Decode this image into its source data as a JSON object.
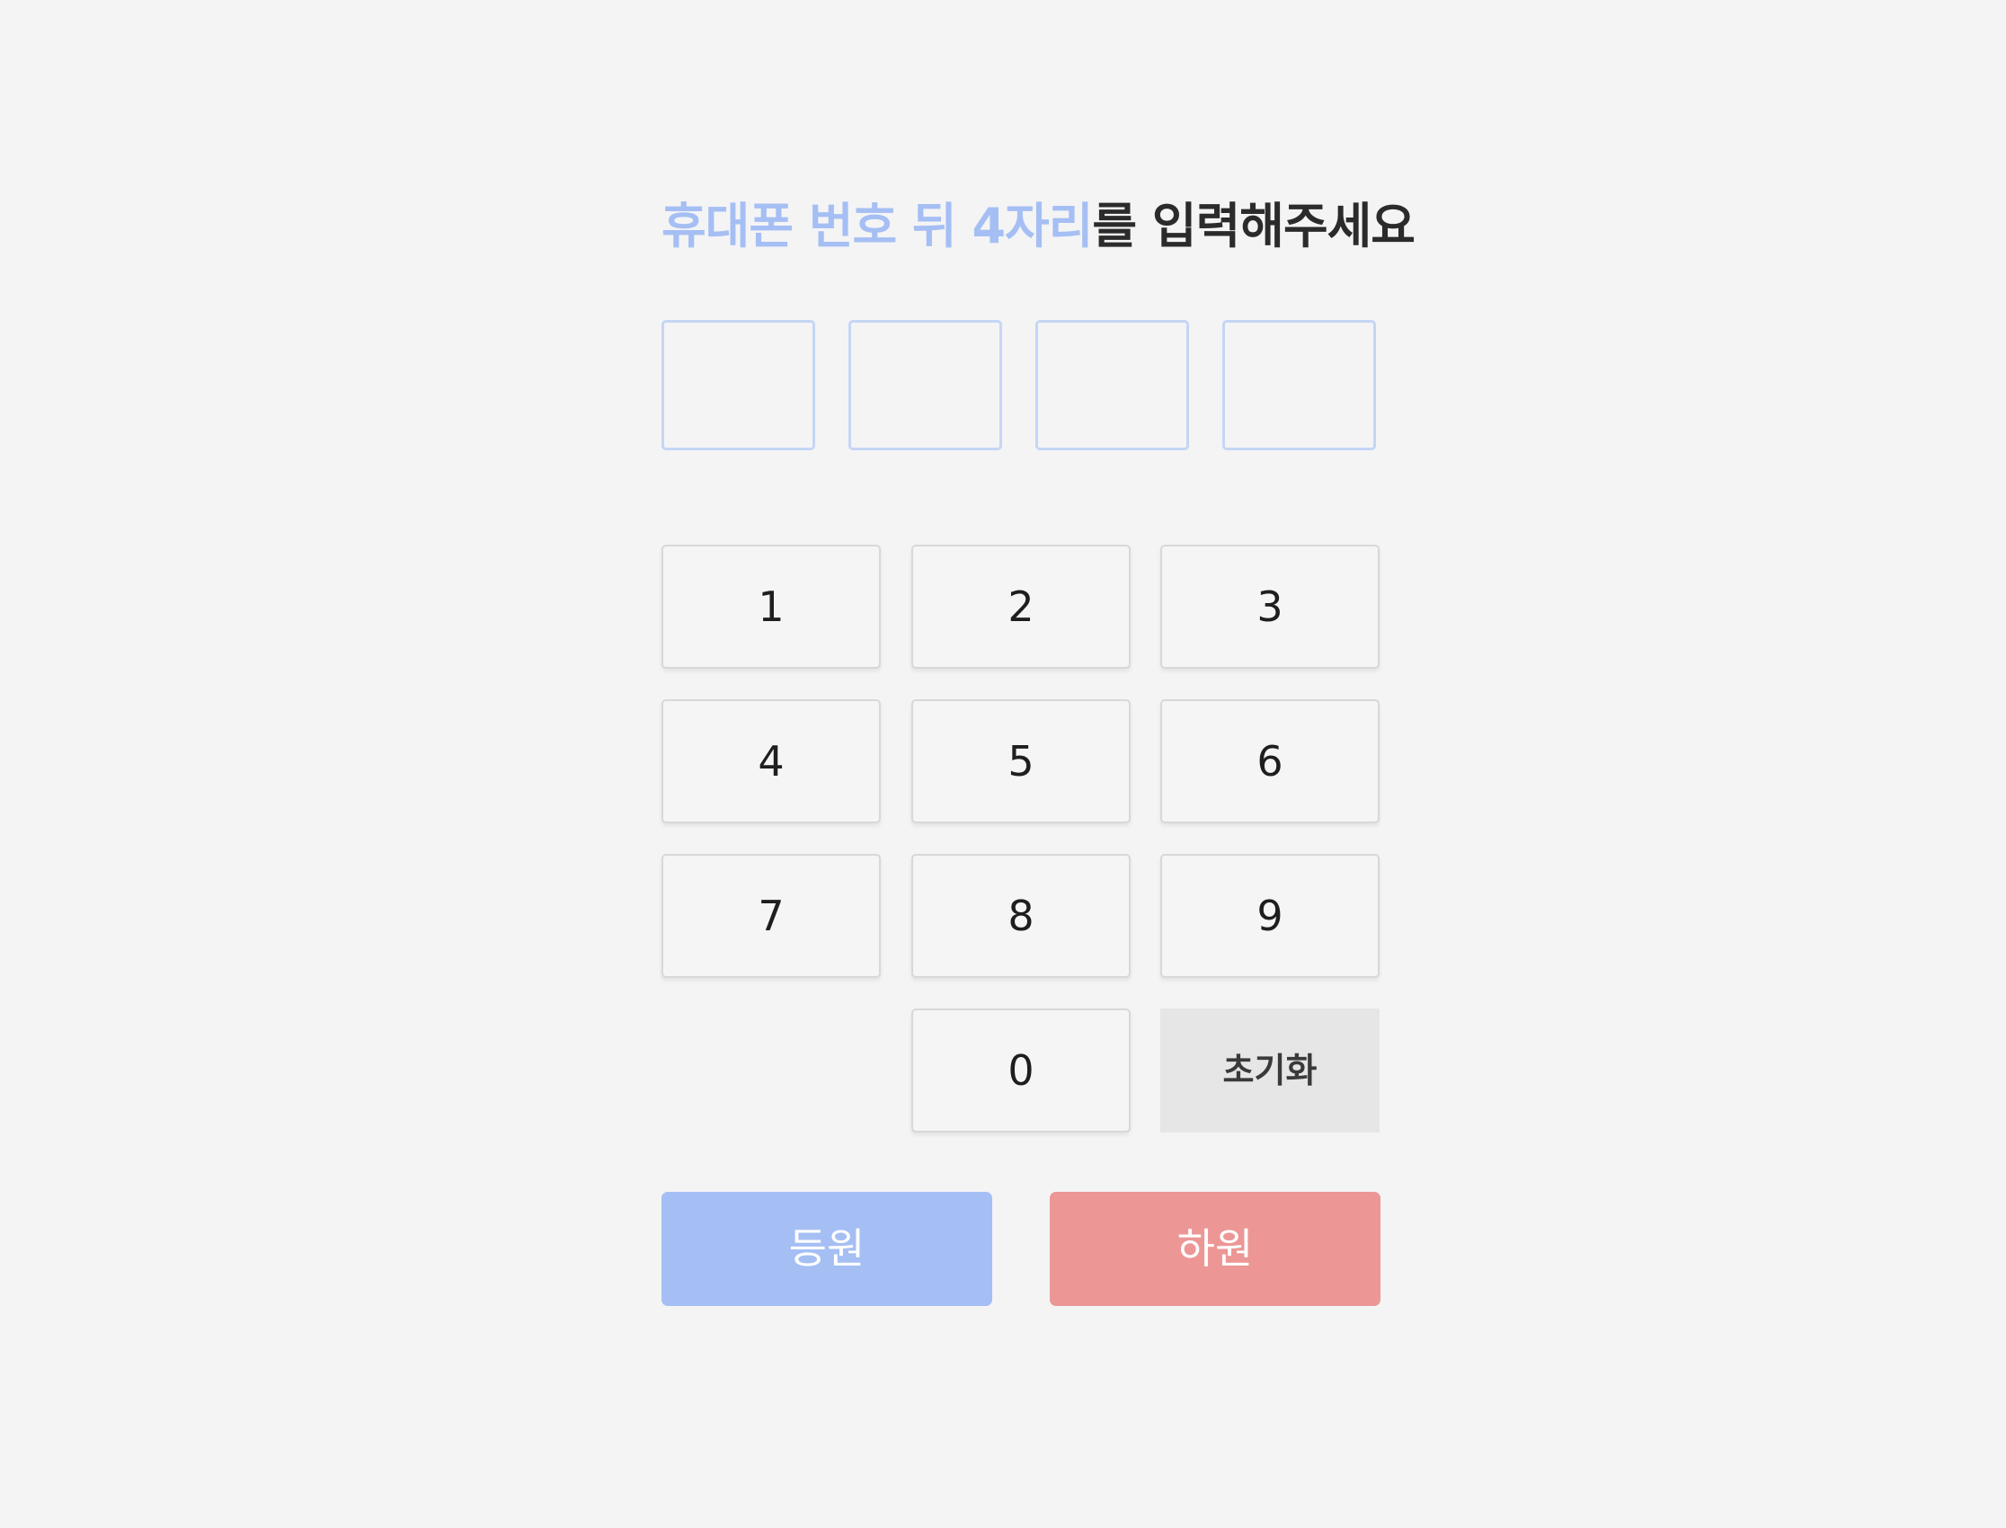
{
  "heading": {
    "highlight": "휴대폰 번호 뒤 4자리",
    "rest": "를 입력해주세요"
  },
  "pin": {
    "digits": [
      "",
      "",
      "",
      ""
    ]
  },
  "keypad": {
    "keys": [
      "1",
      "2",
      "3",
      "4",
      "5",
      "6",
      "7",
      "8",
      "9",
      "0"
    ],
    "reset_label": "초기화"
  },
  "actions": {
    "enter_label": "등원",
    "exit_label": "하원"
  },
  "colors": {
    "accent": "#a5bff4",
    "enter_button": "#a5bff4",
    "exit_button": "#ec9796",
    "background": "#f4f4f5"
  }
}
